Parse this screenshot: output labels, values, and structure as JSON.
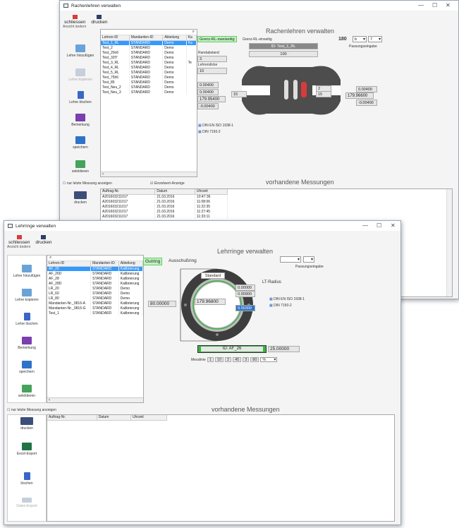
{
  "back": {
    "title": "Rachenlehren verwalten",
    "toolbar": {
      "close": "schliessen",
      "print": "drucken"
    },
    "menu": "Ansicht ändern",
    "sidebar": [
      "Lehre hinzufügen",
      "Lehre kopieren",
      "Lehre löschen",
      "Bemerkung",
      "speichern",
      "selektieren"
    ],
    "columns": [
      "Lehren-ID",
      "Mandanten-ID",
      "Abteilung",
      "Ka"
    ],
    "rows": [
      [
        "Test_1_RL",
        "STANDARD",
        "Demo",
        "Ka"
      ],
      [
        "Test_2",
        "STANDARD",
        "Demo",
        ""
      ],
      [
        "Test_20n6",
        "STANDARD",
        "Demo",
        ""
      ],
      [
        "Test_32f7",
        "STANDARD",
        "Demo",
        ""
      ],
      [
        "Test_3_RL",
        "STANDARD",
        "Demo",
        "Te"
      ],
      [
        "Test_4_RL",
        "STANDARD",
        "Demo",
        ""
      ],
      [
        "Test_5_RL",
        "STANDARD",
        "Demo",
        ""
      ],
      [
        "Test_75h6",
        "STANDARD",
        "Demo",
        ""
      ],
      [
        "Test_85",
        "STANDARD",
        "Demo",
        ""
      ],
      [
        "Test_Neu_2",
        "STANDARD",
        "Demo",
        ""
      ],
      [
        "Test_Neu_3",
        "STANDARD",
        "Demo",
        ""
      ]
    ],
    "main_title": "Rachenlehren verwalten",
    "tab_two": "Grenz-RL-zweiseitig",
    "tab_one": "Grenz-RL-einseitig",
    "id_label": "ID: Test_1_RL",
    "val_180": "180",
    "combo_b": "b",
    "combo_7": "7",
    "passung": "Passungseingabe",
    "dim_100": "100",
    "randabstand_label": "Randabstand",
    "randabstand": "3",
    "lehrendicke_label": "Lehrendicke",
    "lehrendicke": "10",
    "left_vals": [
      "0.00400",
      "0.00400",
      "179.95400",
      "-0.00400",
      "15"
    ],
    "right_vals": [
      "2",
      "15",
      "0.00400",
      "179.96600",
      "-0.00400"
    ],
    "norm1": "DIN EN ISO 1938-1",
    "norm2": "DIN 7150-2",
    "check_last": "nur letzte Messung anzeigen",
    "check_single": "Einzelwert-Anzeige",
    "meas_title": "vorhandene Messungen",
    "meas_columns": [
      "Auftrag-Nr.",
      "Datum",
      "Uhrzeit"
    ],
    "meas_rows": [
      [
        "A201603211017",
        "21.03.2016",
        "10:47:36"
      ],
      [
        "A201603211017",
        "21.03.2016",
        "11:08:06"
      ],
      [
        "A201603211017",
        "21.03.2016",
        "11:22:35"
      ],
      [
        "A201603211017",
        "21.03.2016",
        "11:27:45"
      ],
      [
        "A201603211017",
        "21.03.2016",
        "11:33:11"
      ]
    ],
    "print2": "drucken"
  },
  "front": {
    "title": "Lehrringe verwalten",
    "toolbar": {
      "close": "schliessen",
      "print": "drucken"
    },
    "menu": "Ansicht ändern",
    "sidebar": [
      "Lehre hinzufügen",
      "Lehre kopieren",
      "Lehre löschen",
      "Bemerkung",
      "speichern",
      "selektieren"
    ],
    "columns": [
      "Lehren-ID",
      "Mandanten-ID",
      "Abteilung"
    ],
    "rows": [
      [
        "AF_26",
        "STANDARD",
        "Kalibrierung"
      ],
      [
        "AF_26D",
        "STANDARD",
        "Kalibrierung"
      ],
      [
        "AF_28",
        "STANDARD",
        "Kalibrierung"
      ],
      [
        "AF_28D",
        "STANDARD",
        "Kalibrierung"
      ],
      [
        "LR_20",
        "STANDARD",
        "Demo"
      ],
      [
        "LR_60",
        "STANDARD",
        "Demo"
      ],
      [
        "LR_80",
        "STANDARD",
        "Demo"
      ],
      [
        "Mandanten-Nr._0816-A",
        "STANDARD",
        "Kalibrierung"
      ],
      [
        "Mandanten-Nr._0816-G",
        "STANDARD",
        "Kalibrierung"
      ],
      [
        "Test_1",
        "STANDARD",
        "Kalibrierung"
      ]
    ],
    "main_title": "Lehrringe verwalten",
    "tab_gut": "Gutring",
    "tab_aus": "Ausschußring",
    "passung": "Passungseingabe",
    "standard": "Standard",
    "lt_radius": "LT-Radius",
    "val_pos": "0.00000",
    "val_neg": "0.00900",
    "val_nom": "179.96800",
    "val_tol": "0.00300",
    "dia": "80.00000",
    "id_label": "ID: AF_26",
    "width_val": "25.00000",
    "norm1": "DIN EN ISO 1938-1",
    "norm2": "DIN 7150-2",
    "messlinie_label": "Messlinie",
    "ml_vals": [
      "1",
      "10",
      "2",
      "45",
      "3",
      "80"
    ],
    "ml_unit": "%",
    "check_last": "nur letzte Messung anzeigen",
    "meas_title": "vorhandene Messungen",
    "meas_columns": [
      "Auftrag-Nr.",
      "Datum",
      "Uhrzeit"
    ],
    "bottom_buttons": [
      "drucken",
      "Excel-Export",
      "löschen",
      "Daten-Export"
    ]
  },
  "colors": {
    "select": "#3399ff",
    "green": "#3cb043",
    "red": "#d83b3b"
  }
}
